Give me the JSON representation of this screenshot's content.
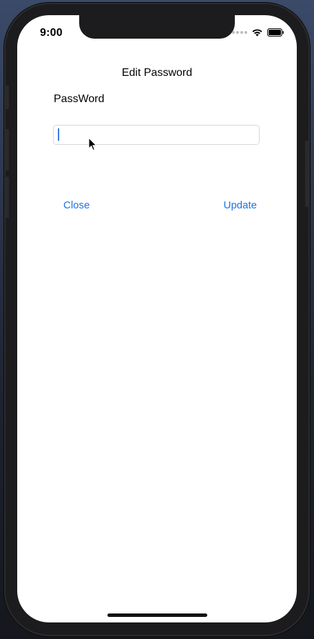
{
  "status_bar": {
    "time": "9:00"
  },
  "screen": {
    "title": "Edit Password",
    "field_label": "PassWord",
    "password_value": "",
    "password_placeholder": ""
  },
  "actions": {
    "close_label": "Close",
    "update_label": "Update"
  },
  "colors": {
    "accent": "#1a73e8",
    "caret": "#3b78e7",
    "background": "#ffffff"
  },
  "icons": {
    "signal": "cellular-signal-icon",
    "wifi": "wifi-icon",
    "battery": "battery-icon",
    "pointer": "mouse-pointer-icon"
  }
}
